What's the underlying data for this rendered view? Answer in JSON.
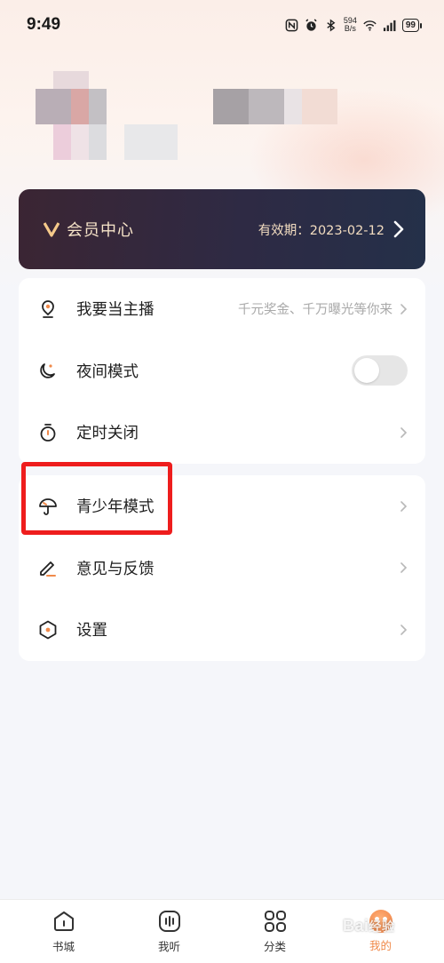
{
  "status_bar": {
    "time": "9:49",
    "net_speed_value": "594",
    "net_speed_unit": "B/s",
    "battery": "99"
  },
  "member": {
    "title": "会员中心",
    "expiry": "有效期：2023-02-12"
  },
  "menu_group_1": [
    {
      "label": "我要当主播",
      "hint": "千元奖金、千万曝光等你来",
      "icon": "anchor-mic-icon"
    },
    {
      "label": "夜间模式",
      "icon": "moon-icon",
      "toggle_on": false
    },
    {
      "label": "定时关闭",
      "icon": "timer-icon"
    }
  ],
  "menu_group_2": [
    {
      "label": "青少年模式",
      "icon": "umbrella-icon"
    },
    {
      "label": "意见与反馈",
      "icon": "pen-feedback-icon"
    },
    {
      "label": "设置",
      "icon": "settings-hexagon-icon"
    }
  ],
  "tabbar": [
    {
      "label": "书城",
      "icon": "house-icon"
    },
    {
      "label": "我听",
      "icon": "audio-wave-icon"
    },
    {
      "label": "分类",
      "icon": "category-grid-icon"
    },
    {
      "label": "我的",
      "icon": "profile-avatar-icon",
      "active": true
    }
  ],
  "watermark": {
    "brand": "Bai",
    "suffix": "经验"
  },
  "colors": {
    "accent": "#f08a4b",
    "vip_gold": "#f6e3c8",
    "vip_bg": "#2e2a44",
    "highlight": "#ee1d1d"
  }
}
